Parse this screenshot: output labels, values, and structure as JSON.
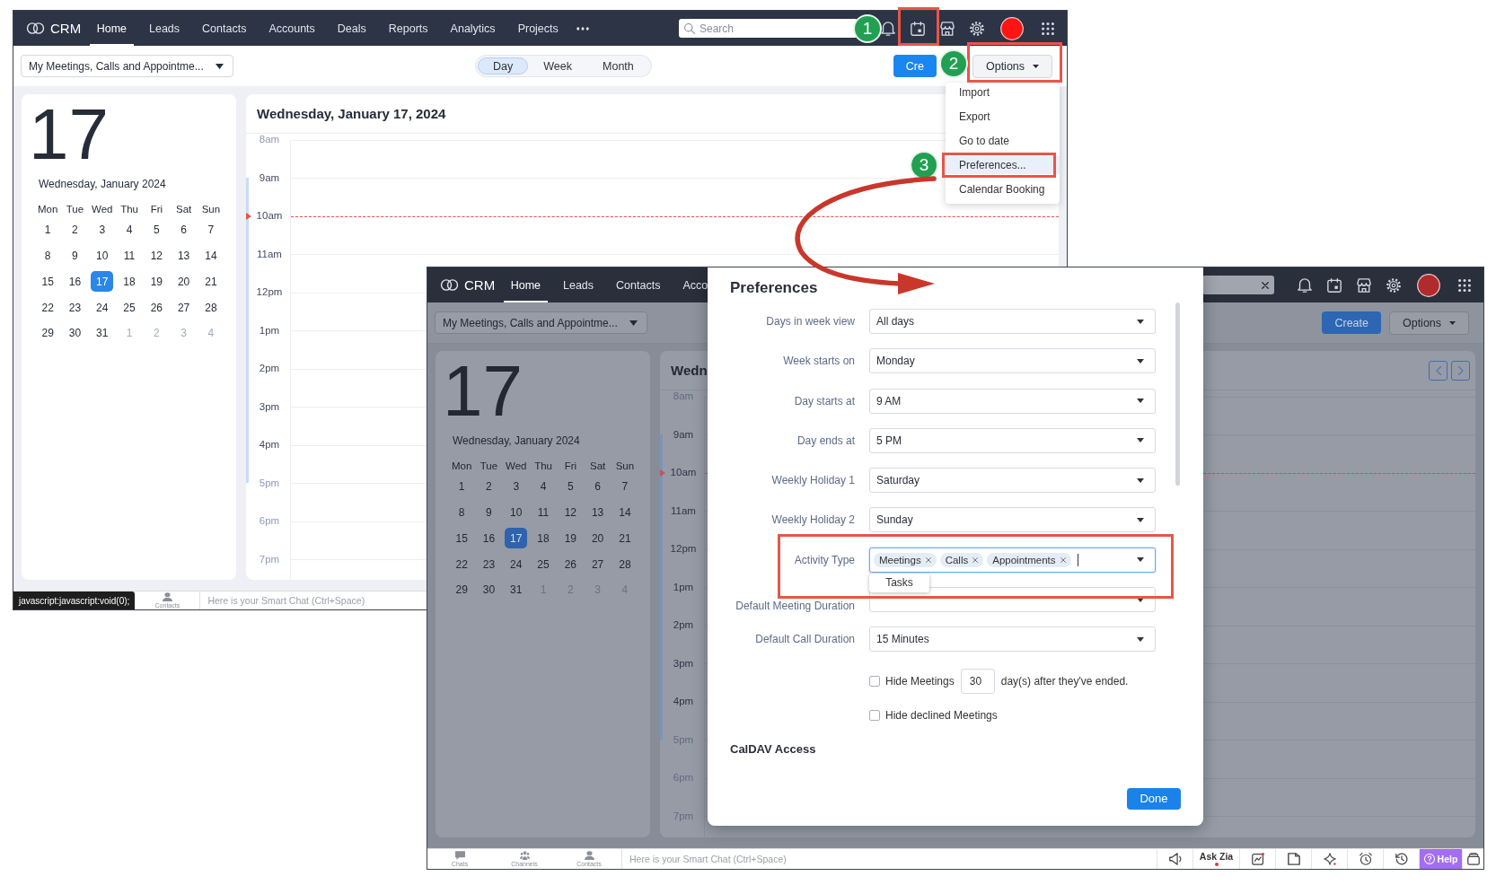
{
  "screenshots": [
    {
      "dimmed": false,
      "nav": {
        "logo": "CRM",
        "tabs": [
          {
            "label": "Home",
            "selected": true
          },
          {
            "label": "Leads",
            "selected": false
          },
          {
            "label": "Contacts",
            "selected": false
          },
          {
            "label": "Accounts",
            "selected": false
          },
          {
            "label": "Deals",
            "selected": false
          },
          {
            "label": "Reports",
            "selected": false
          },
          {
            "label": "Analytics",
            "selected": false
          },
          {
            "label": "Projects",
            "selected": false
          }
        ],
        "more": true,
        "search": {
          "placeholder": "Search"
        }
      },
      "toolbar": {
        "filter": "My Meetings, Calls and Appointme...",
        "views": [
          {
            "label": "Day",
            "selected": true
          },
          {
            "label": "Week",
            "selected": false
          },
          {
            "label": "Month",
            "selected": false
          }
        ],
        "create": "Cre",
        "options": "Options"
      },
      "options_menu": {
        "items": [
          {
            "label": "Import",
            "selected": false
          },
          {
            "label": "Export",
            "selected": false
          },
          {
            "label": "Go to date",
            "selected": false
          },
          {
            "label": "Preferences...",
            "selected": true
          },
          {
            "label": "Calendar Booking",
            "selected": false
          }
        ]
      },
      "mini_calendar": {
        "day": "17",
        "caption": "Wednesday, January 2024",
        "weekdays": [
          "Mon",
          "Tue",
          "Wed",
          "Thu",
          "Fri",
          "Sat",
          "Sun"
        ],
        "days": [
          {
            "label": "1",
            "selected": false,
            "muted": false
          },
          {
            "label": "2",
            "selected": false,
            "muted": false
          },
          {
            "label": "3",
            "selected": false,
            "muted": false
          },
          {
            "label": "4",
            "selected": false,
            "muted": false
          },
          {
            "label": "5",
            "selected": false,
            "muted": false
          },
          {
            "label": "6",
            "selected": false,
            "muted": false
          },
          {
            "label": "7",
            "selected": false,
            "muted": false
          },
          {
            "label": "8",
            "selected": false,
            "muted": false
          },
          {
            "label": "9",
            "selected": false,
            "muted": false
          },
          {
            "label": "10",
            "selected": false,
            "muted": false
          },
          {
            "label": "11",
            "selected": false,
            "muted": false
          },
          {
            "label": "12",
            "selected": false,
            "muted": false
          },
          {
            "label": "13",
            "selected": false,
            "muted": false
          },
          {
            "label": "14",
            "selected": false,
            "muted": false
          },
          {
            "label": "15",
            "selected": false,
            "muted": false
          },
          {
            "label": "16",
            "selected": false,
            "muted": false
          },
          {
            "label": "17",
            "selected": true,
            "muted": false
          },
          {
            "label": "18",
            "selected": false,
            "muted": false
          },
          {
            "label": "19",
            "selected": false,
            "muted": false
          },
          {
            "label": "20",
            "selected": false,
            "muted": false
          },
          {
            "label": "21",
            "selected": false,
            "muted": false
          },
          {
            "label": "22",
            "selected": false,
            "muted": false
          },
          {
            "label": "23",
            "selected": false,
            "muted": false
          },
          {
            "label": "24",
            "selected": false,
            "muted": false
          },
          {
            "label": "25",
            "selected": false,
            "muted": false
          },
          {
            "label": "26",
            "selected": false,
            "muted": false
          },
          {
            "label": "27",
            "selected": false,
            "muted": false
          },
          {
            "label": "28",
            "selected": false,
            "muted": false
          },
          {
            "label": "29",
            "selected": false,
            "muted": false
          },
          {
            "label": "30",
            "selected": false,
            "muted": false
          },
          {
            "label": "31",
            "selected": false,
            "muted": false
          },
          {
            "label": "1",
            "selected": false,
            "muted": true
          },
          {
            "label": "2",
            "selected": false,
            "muted": true
          },
          {
            "label": "3",
            "selected": false,
            "muted": true
          },
          {
            "label": "4",
            "selected": false,
            "muted": true
          }
        ]
      },
      "day_view": {
        "title": "Wednesday, January 17, 2024",
        "hours": [
          {
            "label": "8am",
            "working": false,
            "now": false
          },
          {
            "label": "9am",
            "working": true,
            "now": false
          },
          {
            "label": "10am",
            "working": true,
            "now": true
          },
          {
            "label": "11am",
            "working": true,
            "now": false
          },
          {
            "label": "12pm",
            "working": true,
            "now": false
          },
          {
            "label": "1pm",
            "working": true,
            "now": false
          },
          {
            "label": "2pm",
            "working": true,
            "now": false
          },
          {
            "label": "3pm",
            "working": true,
            "now": false
          },
          {
            "label": "4pm",
            "working": true,
            "now": false
          },
          {
            "label": "5pm",
            "working": false,
            "now": false
          },
          {
            "label": "6pm",
            "working": false,
            "now": false
          },
          {
            "label": "7pm",
            "working": false,
            "now": false
          }
        ]
      },
      "chat_bar": {
        "tooltip": "javascript:javascript:void(0);",
        "shortcuts": [
          {
            "kind": "contacts",
            "label": "Contacts"
          }
        ],
        "prompt": "Here is your Smart Chat (Ctrl+Space)"
      }
    },
    {
      "dimmed": true,
      "nav": {
        "logo": "CRM",
        "tabs": [
          {
            "label": "Home",
            "selected": true
          },
          {
            "label": "Leads",
            "selected": false
          },
          {
            "label": "Contacts",
            "selected": false
          },
          {
            "label": "Acco",
            "selected": false
          }
        ],
        "search": {
          "clearable": true
        }
      },
      "toolbar": {
        "filter": "My Meetings, Calls and Appointme...",
        "create": "Create",
        "options": "Options"
      },
      "mini_calendar": {
        "day": "17",
        "caption": "Wednesday, January 2024",
        "weekdays": [
          "Mon",
          "Tue",
          "Wed",
          "Thu",
          "Fri",
          "Sat",
          "Sun"
        ],
        "days": [
          {
            "label": "1",
            "selected": false,
            "muted": false
          },
          {
            "label": "2",
            "selected": false,
            "muted": false
          },
          {
            "label": "3",
            "selected": false,
            "muted": false
          },
          {
            "label": "4",
            "selected": false,
            "muted": false
          },
          {
            "label": "5",
            "selected": false,
            "muted": false
          },
          {
            "label": "6",
            "selected": false,
            "muted": false
          },
          {
            "label": "7",
            "selected": false,
            "muted": false
          },
          {
            "label": "8",
            "selected": false,
            "muted": false
          },
          {
            "label": "9",
            "selected": false,
            "muted": false
          },
          {
            "label": "10",
            "selected": false,
            "muted": false
          },
          {
            "label": "11",
            "selected": false,
            "muted": false
          },
          {
            "label": "12",
            "selected": false,
            "muted": false
          },
          {
            "label": "13",
            "selected": false,
            "muted": false
          },
          {
            "label": "14",
            "selected": false,
            "muted": false
          },
          {
            "label": "15",
            "selected": false,
            "muted": false
          },
          {
            "label": "16",
            "selected": false,
            "muted": false
          },
          {
            "label": "17",
            "selected": true,
            "muted": false
          },
          {
            "label": "18",
            "selected": false,
            "muted": false
          },
          {
            "label": "19",
            "selected": false,
            "muted": false
          },
          {
            "label": "20",
            "selected": false,
            "muted": false
          },
          {
            "label": "21",
            "selected": false,
            "muted": false
          },
          {
            "label": "22",
            "selected": false,
            "muted": false
          },
          {
            "label": "23",
            "selected": false,
            "muted": false
          },
          {
            "label": "24",
            "selected": false,
            "muted": false
          },
          {
            "label": "25",
            "selected": false,
            "muted": false
          },
          {
            "label": "26",
            "selected": false,
            "muted": false
          },
          {
            "label": "27",
            "selected": false,
            "muted": false
          },
          {
            "label": "28",
            "selected": false,
            "muted": false
          },
          {
            "label": "29",
            "selected": false,
            "muted": false
          },
          {
            "label": "30",
            "selected": false,
            "muted": false
          },
          {
            "label": "31",
            "selected": false,
            "muted": false
          },
          {
            "label": "1",
            "selected": false,
            "muted": true
          },
          {
            "label": "2",
            "selected": false,
            "muted": true
          },
          {
            "label": "3",
            "selected": false,
            "muted": true
          },
          {
            "label": "4",
            "selected": false,
            "muted": true
          }
        ]
      },
      "day_view": {
        "title": "Wedn",
        "pager": [
          {
            "kind": "previous"
          },
          {
            "kind": "next"
          }
        ],
        "hours": [
          {
            "label": "8am",
            "working": false,
            "now": false
          },
          {
            "label": "9am",
            "working": true,
            "now": false
          },
          {
            "label": "10am",
            "working": true,
            "now": true
          },
          {
            "label": "11am",
            "working": true,
            "now": false
          },
          {
            "label": "12pm",
            "working": true,
            "now": false
          },
          {
            "label": "1pm",
            "working": true,
            "now": false
          },
          {
            "label": "2pm",
            "working": true,
            "now": false
          },
          {
            "label": "3pm",
            "working": true,
            "now": false
          },
          {
            "label": "4pm",
            "working": true,
            "now": false
          },
          {
            "label": "5pm",
            "working": false,
            "now": false
          },
          {
            "label": "6pm",
            "working": false,
            "now": false
          },
          {
            "label": "7pm",
            "working": false,
            "now": false
          }
        ]
      },
      "chat_bar": {
        "shortcuts": [
          {
            "kind": "chats",
            "label": "Chats"
          },
          {
            "kind": "channels",
            "label": "Channels"
          },
          {
            "kind": "contacts",
            "label": "Contacts"
          }
        ],
        "prompt": "Here is your Smart Chat (Ctrl+Space)",
        "tools": [
          {
            "kind": "announce"
          },
          {
            "kind": "ask",
            "label": "Ask Zia"
          },
          {
            "kind": "chart"
          },
          {
            "kind": "note"
          },
          {
            "kind": "assistant"
          },
          {
            "kind": "alarm"
          },
          {
            "kind": "history"
          },
          {
            "kind": "help",
            "label": "Help"
          },
          {
            "kind": "box"
          }
        ]
      },
      "dialog": {
        "title": "Preferences",
        "fields": [
          {
            "kind": "select",
            "label": "Days in week view",
            "value": "All days"
          },
          {
            "kind": "select",
            "label": "Week starts on",
            "value": "Monday"
          },
          {
            "kind": "select",
            "label": "Day starts at",
            "value": "9 AM"
          },
          {
            "kind": "select",
            "label": "Day ends at",
            "value": "5 PM"
          },
          {
            "kind": "select",
            "label": "Weekly Holiday 1",
            "value": "Saturday"
          },
          {
            "kind": "select",
            "label": "Weekly Holiday 2",
            "value": "Sunday"
          },
          {
            "kind": "tags",
            "label": "Activity Type",
            "focused": true,
            "tags": [
              "Meetings",
              "Calls",
              "Appointments"
            ],
            "suggestions": [
              "Tasks"
            ]
          },
          {
            "kind": "select",
            "label": "Default Meeting Duration"
          },
          {
            "kind": "select",
            "label": "Default Call Duration",
            "value": "15 Minutes"
          }
        ],
        "options": [
          {
            "kind": "days",
            "label": "Hide Meetings",
            "checked": false,
            "days": "30",
            "suffix": "day(s) after they've ended."
          },
          {
            "kind": "plain",
            "label": "Hide declined Meetings",
            "checked": false
          }
        ],
        "section": "CalDAV Access",
        "done": "Done"
      }
    }
  ],
  "callouts": [
    {
      "label": "1"
    },
    {
      "label": "2"
    },
    {
      "label": "3"
    }
  ]
}
